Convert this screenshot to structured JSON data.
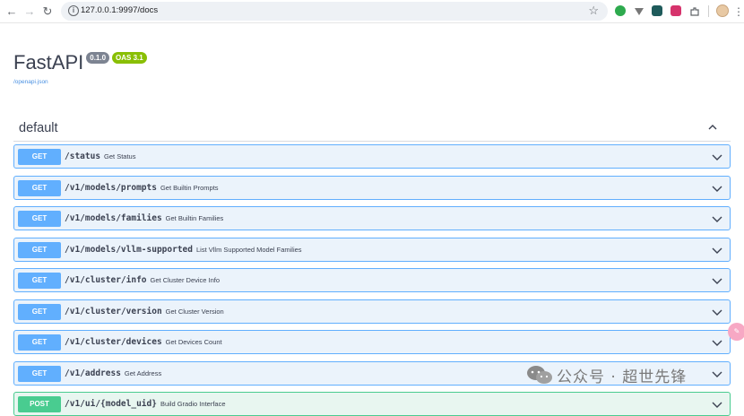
{
  "browser": {
    "url": "127.0.0.1:9997/docs"
  },
  "info": {
    "title": "FastAPI",
    "version": "0.1.0",
    "oas": "OAS 3.1",
    "spec_link": "/openapi.json"
  },
  "section": {
    "title": "default"
  },
  "operations": [
    {
      "method": "GET",
      "path": "/status",
      "summary": "Get Status"
    },
    {
      "method": "GET",
      "path": "/v1/models/prompts",
      "summary": "Get Builtin Prompts"
    },
    {
      "method": "GET",
      "path": "/v1/models/families",
      "summary": "Get Builtin Families"
    },
    {
      "method": "GET",
      "path": "/v1/models/vllm-supported",
      "summary": "List Vllm Supported Model Families"
    },
    {
      "method": "GET",
      "path": "/v1/cluster/info",
      "summary": "Get Cluster Device Info"
    },
    {
      "method": "GET",
      "path": "/v1/cluster/version",
      "summary": "Get Cluster Version"
    },
    {
      "method": "GET",
      "path": "/v1/cluster/devices",
      "summary": "Get Devices Count"
    },
    {
      "method": "GET",
      "path": "/v1/address",
      "summary": "Get Address"
    },
    {
      "method": "POST",
      "path": "/v1/ui/{model_uid}",
      "summary": "Build Gradio Interface"
    }
  ],
  "watermark": {
    "text": "公众号 · 超世先锋"
  },
  "colors": {
    "get": "#61affe",
    "post": "#49cc90"
  }
}
